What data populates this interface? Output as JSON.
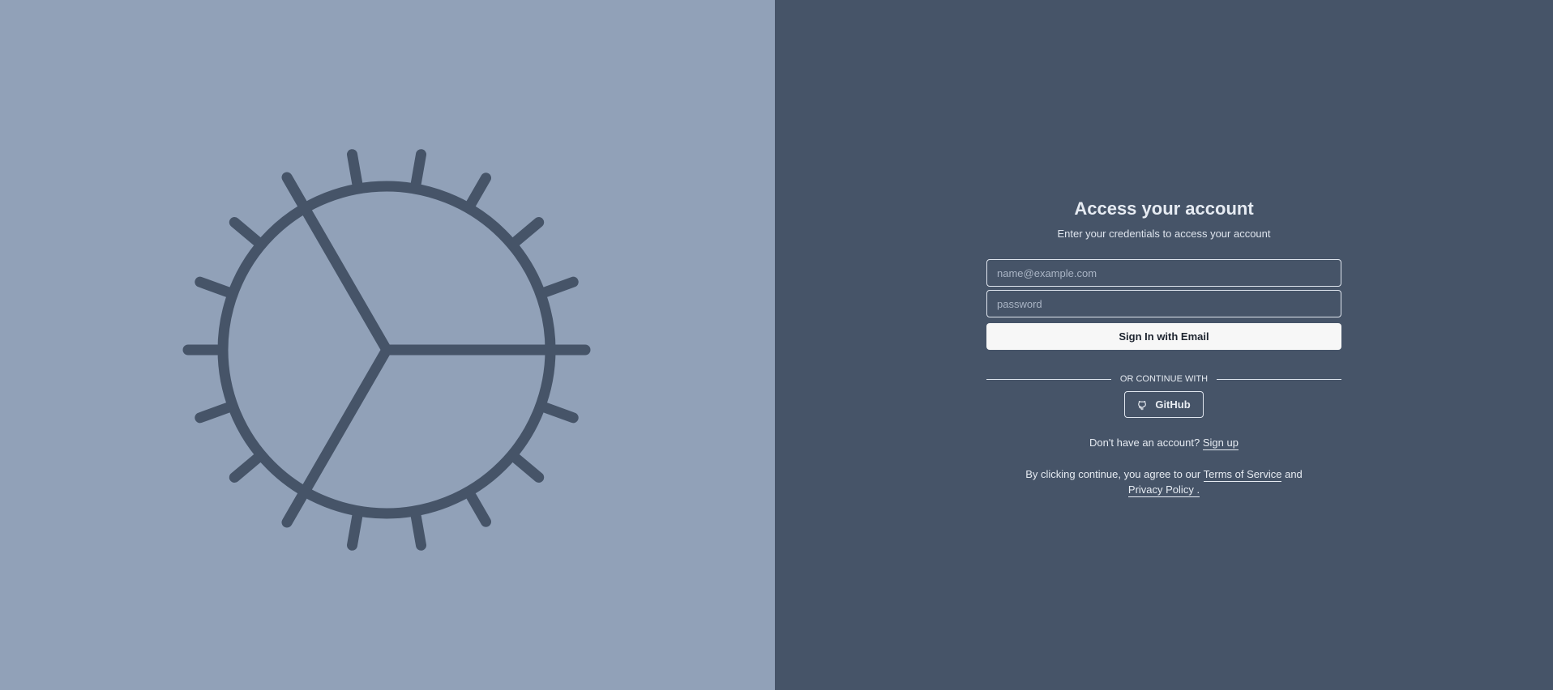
{
  "colors": {
    "left_bg": "#91a1b8",
    "right_bg": "#465468",
    "logo_stroke": "#465468"
  },
  "logo": {
    "icon": "sun-wheel-logo-icon"
  },
  "form": {
    "title": "Access your account",
    "subtitle": "Enter your credentials to access your account",
    "email_placeholder": "name@example.com",
    "email_value": "",
    "password_placeholder": "password",
    "password_value": "",
    "signin_label": "Sign In with Email",
    "divider_text": "OR CONTINUE WITH",
    "github_label": "GitHub",
    "github_icon": "github-icon"
  },
  "signup": {
    "prefix": "Don't have an account?",
    "link": "Sign up"
  },
  "terms": {
    "prefix": "By clicking continue, you agree to our",
    "tos_link": "Terms of Service",
    "and": "and",
    "privacy_link": "Privacy Policy",
    "suffix": "."
  }
}
